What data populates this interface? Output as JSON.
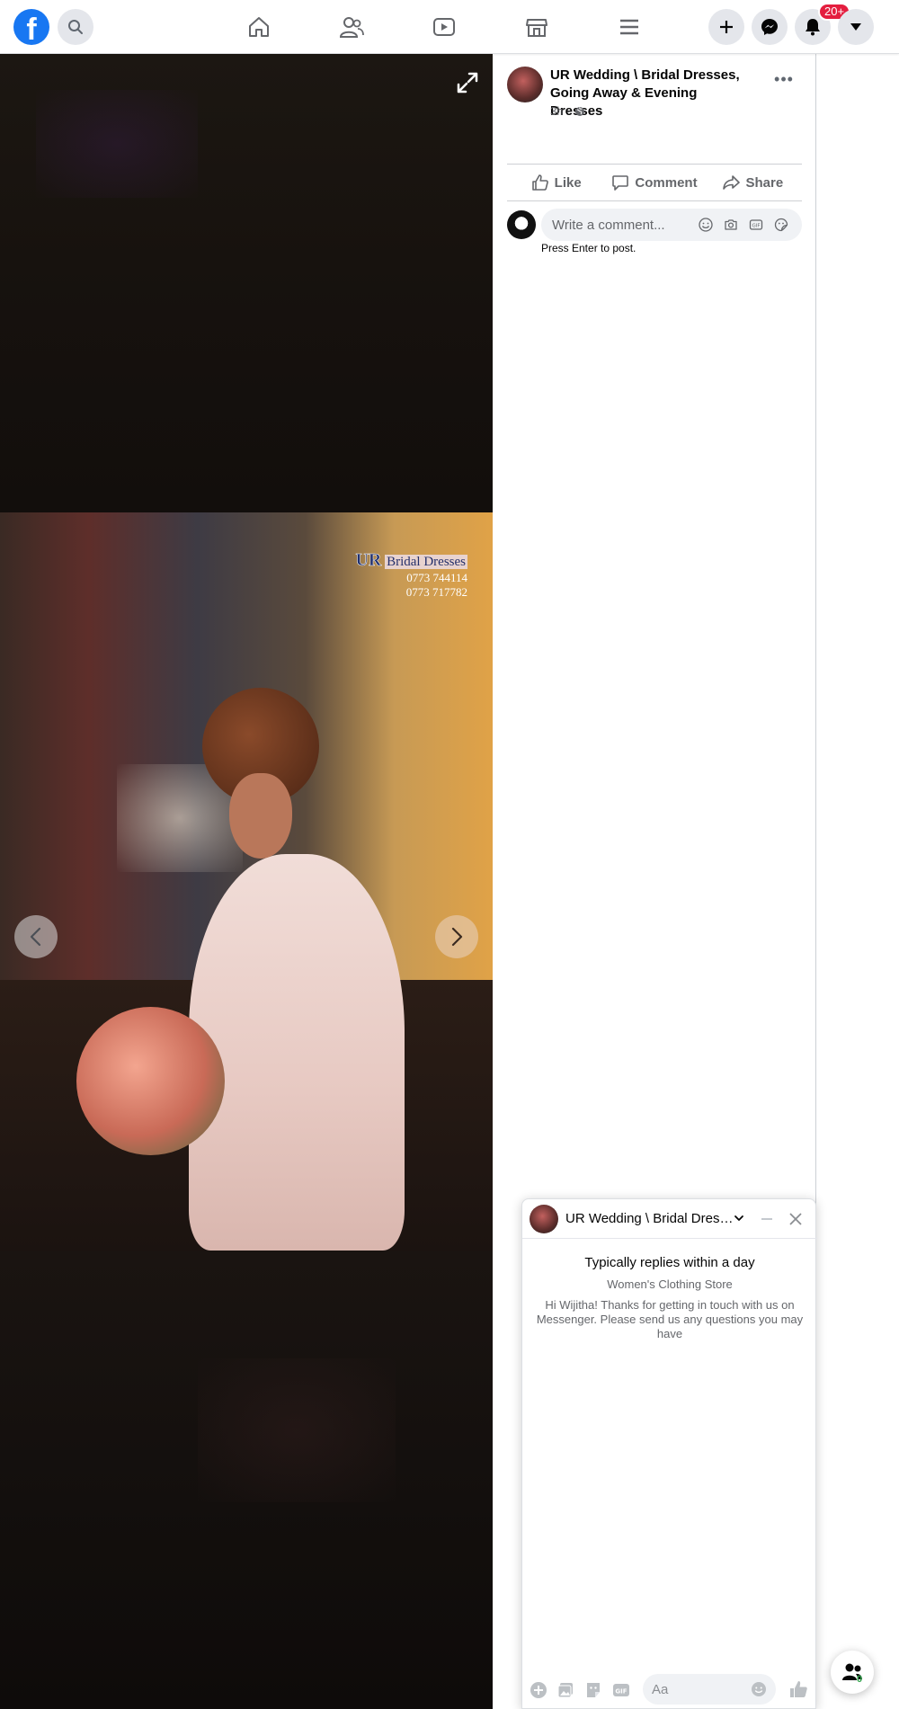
{
  "topbar": {
    "logo": "f",
    "notifications_badge": "20+",
    "icons": [
      "facebook-logo",
      "search-icon",
      "home-icon",
      "friends-icon",
      "watch-icon",
      "marketplace-icon",
      "menu-icon",
      "plus-icon",
      "messenger-icon",
      "bell-icon",
      "caret-down-icon"
    ]
  },
  "photo": {
    "watermark_brand": "UR",
    "watermark_title": "Bridal Dresses",
    "phones": [
      "0773 744114",
      "0773 717782"
    ]
  },
  "post": {
    "page_name": "UR Wedding \\ Bridal Dresses, Going Away & Evening Dresses",
    "time": "3h",
    "more": "•••",
    "actions": {
      "like": "Like",
      "comment": "Comment",
      "share": "Share"
    },
    "comment_placeholder": "Write a comment...",
    "press_enter": "Press Enter to post."
  },
  "chat": {
    "title": "UR Wedding \\ Bridal Dresses, Going Away & Evening Dresses",
    "replies": "Typically replies within a day",
    "category": "Women's Clothing Store",
    "greeting": "Hi Wijitha! Thanks for getting in touch with us on Messenger. Please send us any questions you may have",
    "input_placeholder": "Aa"
  },
  "contacts": {
    "count": "0"
  },
  "colors": {
    "brand": "#1877f2",
    "badge": "#e41e3f",
    "text_secondary": "#65676b"
  }
}
